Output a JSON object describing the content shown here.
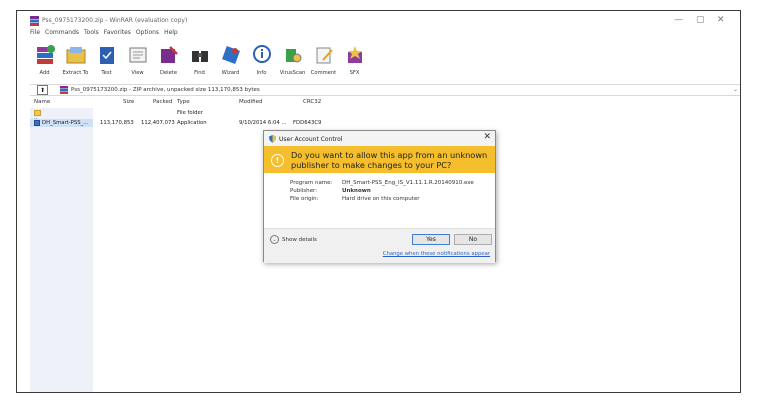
{
  "window": {
    "title": "Pss_0975173200.zip - WinRAR (evaluation copy)",
    "minimize_glyph": "—",
    "maximize_glyph": "▢",
    "close_glyph": "✕"
  },
  "menu": [
    "File",
    "Commands",
    "Tools",
    "Favorites",
    "Options",
    "Help"
  ],
  "toolbar": [
    {
      "label": "Add",
      "icon": "add-archive-icon"
    },
    {
      "label": "Extract To",
      "icon": "extract-to-icon"
    },
    {
      "label": "Test",
      "icon": "test-icon"
    },
    {
      "label": "View",
      "icon": "view-icon"
    },
    {
      "label": "Delete",
      "icon": "delete-icon"
    },
    {
      "label": "Find",
      "icon": "find-icon"
    },
    {
      "label": "Wizard",
      "icon": "wizard-icon"
    },
    {
      "label": "Info",
      "icon": "info-icon"
    },
    {
      "label": "VirusScan",
      "icon": "virusscan-icon"
    },
    {
      "label": "Comment",
      "icon": "comment-icon"
    },
    {
      "label": "SFX",
      "icon": "sfx-icon"
    }
  ],
  "address": {
    "up_glyph": "⬆",
    "text": "Pss_0975173200.zip - ZIP archive, unpacked size 113,170,853 bytes",
    "dropdown_glyph": "⌄"
  },
  "columns": {
    "name": "Name",
    "size": "Size",
    "packed": "Packed",
    "type": "Type",
    "modified": "Modified",
    "crc": "CRC32"
  },
  "rows": [
    {
      "name": "..",
      "size": "",
      "packed": "",
      "type": "File folder",
      "modified": "",
      "crc": "",
      "icon": "folder-icon"
    },
    {
      "name": "DH_Smart-PSS_...",
      "size": "113,170,853",
      "packed": "112,407,073",
      "type": "Application",
      "modified": "9/10/2014 6:04 ...",
      "crc": "FDD643C9",
      "icon": "exe-icon"
    }
  ],
  "uac": {
    "title": "User Account Control",
    "close_glyph": "✕",
    "warn_glyph": "!",
    "question": "Do you want to allow this app from an unknown publisher to make changes to your PC?",
    "program_name_label": "Program name:",
    "program_name": "DH_Smart-PSS_Eng_IS_V1.11.1.R.20140910.exe",
    "publisher_label": "Publisher:",
    "publisher": "Unknown",
    "file_origin_label": "File origin:",
    "file_origin": "Hard drive on this computer",
    "show_details": "Show details",
    "chevron_glyph": "⌄",
    "yes": "Yes",
    "no": "No",
    "notifications_link": "Change when these notifications appear"
  },
  "colors": {
    "uac_banner": "#f5be2c",
    "link": "#2b5fc4",
    "selection": "#cfe0f7"
  }
}
